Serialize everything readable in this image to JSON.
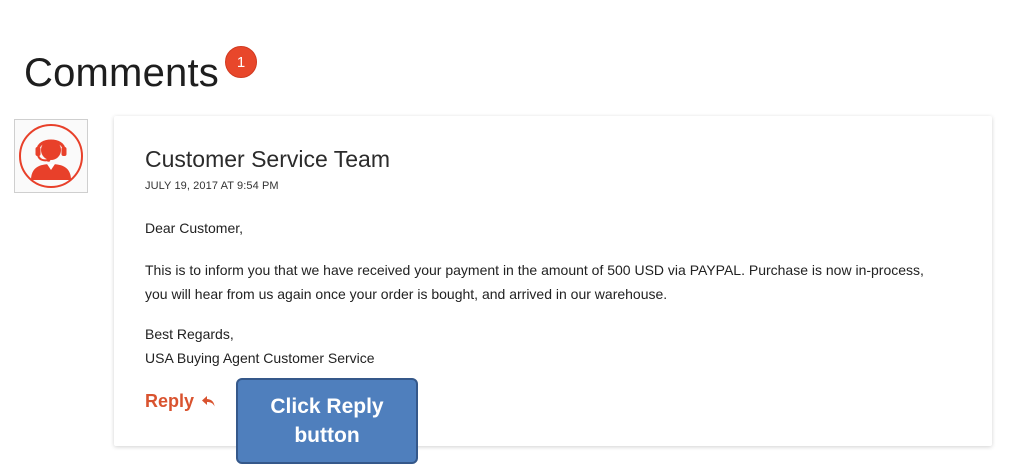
{
  "comments": {
    "title": "Comments",
    "count": "1"
  },
  "comment": {
    "author": "Customer Service Team",
    "date": "JULY 19, 2017 AT 9:54 PM",
    "greeting": "Dear Customer,",
    "paragraph_line1": "This is to inform you that we have received your payment in the amount of 500 USD via PAYPAL. Purchase is now in-process,",
    "paragraph_line2": "you will hear from us again once your order is bought, and arrived in our warehouse.",
    "signoff_line1": "Best Regards,",
    "signoff_line2": "USA Buying Agent Customer Service",
    "reply_label": "Reply",
    "avatar_icon": "customer-service-headset-icon",
    "reply_icon": "reply-arrow-icon"
  },
  "callout": {
    "line1": "Click Reply",
    "line2": "button"
  },
  "colors": {
    "accent": "#d9532f",
    "badge": "#e8472b",
    "callout": "#4f7fbd",
    "avatar": "#e8402a"
  }
}
